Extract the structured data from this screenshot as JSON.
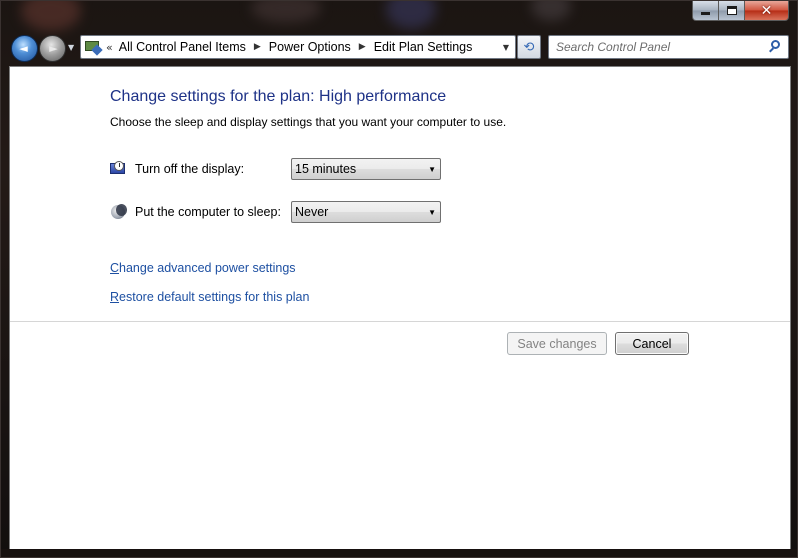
{
  "window": {
    "caption_buttons": [
      "minimize",
      "maximize",
      "close"
    ],
    "close_glyph": "✕"
  },
  "nav": {
    "back_glyph": "◄",
    "forward_glyph": "►",
    "dropdown_glyph": "▼"
  },
  "address": {
    "overflow_glyph": "«",
    "crumbs": [
      "All Control Panel Items",
      "Power Options",
      "Edit Plan Settings"
    ],
    "separator_glyph": "▶",
    "dropdown_glyph": "▼",
    "refresh_glyph": "⟲"
  },
  "search": {
    "placeholder": "Search Control Panel",
    "value": ""
  },
  "main": {
    "title": "Change settings for the plan: High performance",
    "subtitle": "Choose the sleep and display settings that you want your computer to use.",
    "settings": [
      {
        "label": "Turn off the display:",
        "value": "15 minutes",
        "icon": "display-timer-icon"
      },
      {
        "label": "Put the computer to sleep:",
        "value": "Never",
        "icon": "sleep-moon-icon"
      }
    ],
    "caret_glyph": "▼",
    "links": {
      "advanced_first": "C",
      "advanced_rest": "hange advanced power settings",
      "restore_first": "R",
      "restore_rest": "estore default settings for this plan"
    },
    "buttons": {
      "save": "Save changes",
      "cancel": "Cancel"
    }
  },
  "colors": {
    "title_blue": "#1e3287",
    "link_blue": "#1e50a2",
    "close_red": "#c53a22"
  }
}
